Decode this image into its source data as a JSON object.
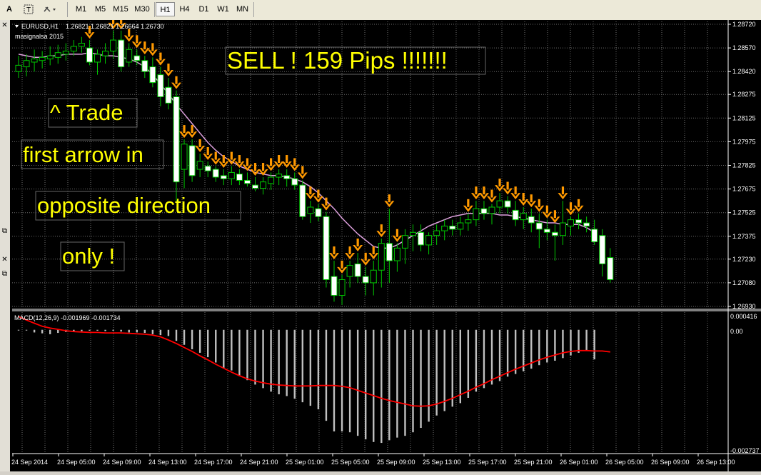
{
  "toolbar": {
    "left_icons": [
      "text-a-icon",
      "text-box-icon",
      "tool-dropdown-icon"
    ],
    "timeframes": [
      "M1",
      "M5",
      "M15",
      "M30",
      "H1",
      "H4",
      "D1",
      "W1",
      "MN"
    ],
    "active_timeframe": "H1"
  },
  "left_strip": {
    "icons": [
      "close-icon",
      "resize-icon",
      "close-icon",
      "resize-icon"
    ]
  },
  "chart": {
    "symbol_label": "EURUSD,H1",
    "ohlc_label": "1.26821 1.26821 1.26664 1.26730",
    "indicator_label": "masignalsa 2015",
    "price_levels": [
      "1.28720",
      "1.28570",
      "1.28420",
      "1.28275",
      "1.28125",
      "1.27975",
      "1.27825",
      "1.27675",
      "1.27525",
      "1.27375",
      "1.27230",
      "1.27080",
      "1.26930"
    ],
    "time_labels": [
      "24 Sep 2014",
      "24 Sep 05:00",
      "24 Sep 09:00",
      "24 Sep 13:00",
      "24 Sep 17:00",
      "24 Sep 21:00",
      "25 Sep 01:00",
      "25 Sep 05:00",
      "25 Sep 09:00",
      "25 Sep 13:00",
      "25 Sep 17:00",
      "25 Sep 21:00",
      "26 Sep 01:00",
      "26 Sep 05:00",
      "26 Sep 09:00",
      "26 Sep 13:00"
    ],
    "colors": {
      "background": "#000000",
      "grid": "#6b6b6b",
      "candle_up": "#000000",
      "candle_down": "#ffffff",
      "wick": "#00c800",
      "ma_line": "#dda0dd",
      "arrow": "#ff9900",
      "annotation_text": "#ffff00",
      "macd_histogram": "#c0c0c0",
      "macd_signal": "#ff0000"
    }
  },
  "annotations": {
    "sell": "SELL !  159 Pips !!!!!!!",
    "trade": "^ Trade",
    "first_arrow": "first arrow in",
    "opposite": "opposite direction",
    "only": "only !"
  },
  "macd": {
    "label": "MACD(12,26,9) -0.001969 -0.001734",
    "scale_top": "0.000416",
    "scale_zero": "0.00",
    "scale_bottom": "-0.002737"
  },
  "chart_data": {
    "type": "candlestick",
    "symbol": "EURUSD",
    "timeframe": "H1",
    "ylim": [
      1.2693,
      1.2872
    ],
    "candles": [
      [
        1.2842,
        1.2852,
        1.2838,
        1.2846
      ],
      [
        1.2845,
        1.2853,
        1.2839,
        1.2849
      ],
      [
        1.2848,
        1.2856,
        1.2842,
        1.285
      ],
      [
        1.2849,
        1.2855,
        1.2844,
        1.2851
      ],
      [
        1.285,
        1.2858,
        1.2846,
        1.2852
      ],
      [
        1.2851,
        1.2859,
        1.2847,
        1.2854
      ],
      [
        1.2853,
        1.286,
        1.2849,
        1.2855
      ],
      [
        1.2855,
        1.2862,
        1.2852,
        1.2858
      ],
      [
        1.2858,
        1.2864,
        1.2854,
        1.286
      ],
      [
        1.2857,
        1.2862,
        1.2846,
        1.2848
      ],
      [
        1.2848,
        1.2856,
        1.284,
        1.2853
      ],
      [
        1.2852,
        1.286,
        1.2847,
        1.2855
      ],
      [
        1.2855,
        1.2868,
        1.285,
        1.2862
      ],
      [
        1.2862,
        1.2868,
        1.2842,
        1.2845
      ],
      [
        1.2848,
        1.286,
        1.2845,
        1.2856
      ],
      [
        1.2852,
        1.2856,
        1.2846,
        1.2849
      ],
      [
        1.2849,
        1.2852,
        1.2838,
        1.2842
      ],
      [
        1.2845,
        1.2851,
        1.2832,
        1.2835
      ],
      [
        1.284,
        1.2845,
        1.282,
        1.2826
      ],
      [
        1.2832,
        1.2838,
        1.2818,
        1.2822
      ],
      [
        1.2826,
        1.283,
        1.276,
        1.2772
      ],
      [
        1.278,
        1.2799,
        1.2768,
        1.2796
      ],
      [
        1.2795,
        1.2799,
        1.2772,
        1.2776
      ],
      [
        1.278,
        1.279,
        1.2775,
        1.2785
      ],
      [
        1.2782,
        1.2785,
        1.2775,
        1.2779
      ],
      [
        1.278,
        1.2782,
        1.2772,
        1.2775
      ],
      [
        1.2776,
        1.278,
        1.277,
        1.2774
      ],
      [
        1.2774,
        1.2782,
        1.277,
        1.2778
      ],
      [
        1.2777,
        1.278,
        1.277,
        1.2773
      ],
      [
        1.2773,
        1.2778,
        1.2769,
        1.2771
      ],
      [
        1.277,
        1.2775,
        1.2766,
        1.2768
      ],
      [
        1.2768,
        1.2775,
        1.2764,
        1.2772
      ],
      [
        1.2771,
        1.2778,
        1.2767,
        1.2775
      ],
      [
        1.2775,
        1.278,
        1.277,
        1.2777
      ],
      [
        1.2776,
        1.278,
        1.2769,
        1.2774
      ],
      [
        1.2774,
        1.2778,
        1.2767,
        1.277
      ],
      [
        1.277,
        1.2773,
        1.2748,
        1.275
      ],
      [
        1.2752,
        1.276,
        1.2746,
        1.2756
      ],
      [
        1.2755,
        1.2758,
        1.2747,
        1.275
      ],
      [
        1.275,
        1.2753,
        1.2705,
        1.271
      ],
      [
        1.2712,
        1.2722,
        1.2696,
        1.27
      ],
      [
        1.27,
        1.2713,
        1.2694,
        1.271
      ],
      [
        1.2712,
        1.2722,
        1.2705,
        1.2719
      ],
      [
        1.272,
        1.2727,
        1.2708,
        1.2712
      ],
      [
        1.2712,
        1.2718,
        1.27,
        1.2708
      ],
      [
        1.2708,
        1.2722,
        1.27,
        1.2716
      ],
      [
        1.2716,
        1.2736,
        1.2705,
        1.2733
      ],
      [
        1.2733,
        1.2755,
        1.2708,
        1.2722
      ],
      [
        1.2722,
        1.2733,
        1.2715,
        1.273
      ],
      [
        1.273,
        1.2742,
        1.272,
        1.2738
      ],
      [
        1.2738,
        1.2745,
        1.2728,
        1.274
      ],
      [
        1.274,
        1.2745,
        1.2728,
        1.2732
      ],
      [
        1.2732,
        1.274,
        1.2726,
        1.2738
      ],
      [
        1.2738,
        1.2745,
        1.2732,
        1.2741
      ],
      [
        1.2741,
        1.2748,
        1.2735,
        1.2744
      ],
      [
        1.2744,
        1.2748,
        1.2738,
        1.2742
      ],
      [
        1.2742,
        1.275,
        1.2738,
        1.2746
      ],
      [
        1.2746,
        1.2752,
        1.2741,
        1.2748
      ],
      [
        1.2748,
        1.276,
        1.2744,
        1.2755
      ],
      [
        1.2755,
        1.276,
        1.2748,
        1.2752
      ],
      [
        1.2752,
        1.2758,
        1.2745,
        1.2756
      ],
      [
        1.2756,
        1.2765,
        1.2752,
        1.276
      ],
      [
        1.276,
        1.2763,
        1.2752,
        1.2756
      ],
      [
        1.2754,
        1.276,
        1.2744,
        1.2748
      ],
      [
        1.2748,
        1.2756,
        1.2742,
        1.2752
      ],
      [
        1.275,
        1.2755,
        1.274,
        1.2746
      ],
      [
        1.2746,
        1.2752,
        1.273,
        1.2742
      ],
      [
        1.2742,
        1.2748,
        1.2735,
        1.274
      ],
      [
        1.274,
        1.2745,
        1.2722,
        1.2738
      ],
      [
        1.2738,
        1.276,
        1.2732,
        1.2746
      ],
      [
        1.2744,
        1.275,
        1.2738,
        1.2748
      ],
      [
        1.2748,
        1.2752,
        1.2742,
        1.2746
      ],
      [
        1.2746,
        1.275,
        1.274,
        1.2744
      ],
      [
        1.2742,
        1.2748,
        1.2732,
        1.2734
      ],
      [
        1.2738,
        1.2742,
        1.2712,
        1.272
      ],
      [
        1.2724,
        1.273,
        1.2708,
        1.271
      ]
    ],
    "ma_line": [
      1.2853,
      1.2852,
      1.2851,
      1.2851,
      1.2852,
      1.2852,
      1.2853,
      1.2853,
      1.2853,
      1.2854,
      1.2853,
      1.2852,
      1.2852,
      1.2851,
      1.285,
      1.2848,
      1.2845,
      1.284,
      1.2834,
      1.2828,
      1.2821,
      1.2815,
      1.2809,
      1.2803,
      1.2797,
      1.2792,
      1.2788,
      1.2785,
      1.2782,
      1.278,
      1.2778,
      1.2777,
      1.2776,
      1.2776,
      1.2775,
      1.2774,
      1.2772,
      1.2769,
      1.2765,
      1.276,
      1.2755,
      1.2749,
      1.2744,
      1.2739,
      1.2735,
      1.2731,
      1.273,
      1.273,
      1.2732,
      1.2735,
      1.2738,
      1.2741,
      1.2744,
      1.2746,
      1.2748,
      1.275,
      1.2751,
      1.2752,
      1.2752,
      1.2752,
      1.2752,
      1.2751,
      1.2751,
      1.275,
      1.2749,
      1.2748,
      1.2747,
      1.2746,
      1.2746,
      1.2745,
      1.2745,
      1.2745,
      1.2743,
      1.274
    ],
    "sell_arrows_at": [
      9,
      12,
      13,
      14,
      15,
      16,
      17,
      18,
      19,
      20,
      21,
      22,
      23,
      24,
      25,
      26,
      27,
      28,
      29,
      30,
      31,
      32,
      33,
      34,
      35,
      36,
      37,
      38,
      39,
      40,
      41,
      42,
      43,
      44,
      45,
      46,
      47,
      48,
      57,
      58,
      59,
      60,
      61,
      62,
      63,
      64,
      65,
      66,
      67,
      68,
      69,
      70,
      71
    ],
    "macd_histogram": [
      0.0,
      0.0,
      -6e-05,
      -8e-05,
      -0.0001,
      -7e-05,
      -5e-05,
      -4e-05,
      -3e-05,
      -2e-05,
      -2e-05,
      -3e-05,
      -2e-05,
      -4e-05,
      -6e-05,
      -6e-05,
      -7e-05,
      -0.0001,
      -0.00012,
      -0.00014,
      -0.00025,
      -0.00034,
      -0.00044,
      -0.00052,
      -0.00062,
      -0.00074,
      -0.00086,
      -0.00092,
      -0.00104,
      -0.00114,
      -0.00124,
      -0.00132,
      -0.0014,
      -0.00146,
      -0.0015,
      -0.00156,
      -0.00164,
      -0.00172,
      -0.0018,
      -0.00206,
      -0.0023,
      -0.0023,
      -0.00232,
      -0.0024,
      -0.00248,
      -0.00254,
      -0.00256,
      -0.0025,
      -0.00244,
      -0.0024,
      -0.00232,
      -0.00222,
      -0.00208,
      -0.00194,
      -0.00184,
      -0.00174,
      -0.00166,
      -0.00154,
      -0.0014,
      -0.00132,
      -0.00124,
      -0.00116,
      -0.00106,
      -0.001,
      -0.00094,
      -0.00088,
      -0.0008,
      -0.00074,
      -0.0007,
      -0.00064,
      -0.00058,
      -0.00052,
      -0.00047,
      -0.00067
    ],
    "macd_signal": [
      0.0003,
      0.00022,
      0.00015,
      8e-05,
      4e-05,
      1e-05,
      -2e-05,
      -4e-05,
      -5e-05,
      -6e-05,
      -6e-05,
      -7e-05,
      -7e-05,
      -7e-05,
      -8e-05,
      -9e-05,
      -0.0001,
      -0.00012,
      -0.00016,
      -0.00023,
      -0.00031,
      -0.0004,
      -0.00049,
      -0.00059,
      -0.00068,
      -0.00078,
      -0.00087,
      -0.00096,
      -0.00104,
      -0.00111,
      -0.00116,
      -0.0012,
      -0.00123,
      -0.00125,
      -0.00126,
      -0.00127,
      -0.00127,
      -0.00127,
      -0.00126,
      -0.00126,
      -0.00126,
      -0.00128,
      -0.00131,
      -0.00137,
      -0.00143,
      -0.00149,
      -0.00155,
      -0.0016,
      -0.00164,
      -0.00168,
      -0.00172,
      -0.00173,
      -0.00172,
      -0.00168,
      -0.00162,
      -0.00155,
      -0.00147,
      -0.00139,
      -0.0013,
      -0.00122,
      -0.00113,
      -0.00105,
      -0.00097,
      -0.00089,
      -0.00082,
      -0.00075,
      -0.00068,
      -0.00062,
      -0.00057,
      -0.00052,
      -0.00049,
      -0.00047,
      -0.00047,
      -0.00048,
      -0.00048,
      -0.0005
    ],
    "macd_ylim": [
      -0.002737,
      0.000416
    ]
  }
}
